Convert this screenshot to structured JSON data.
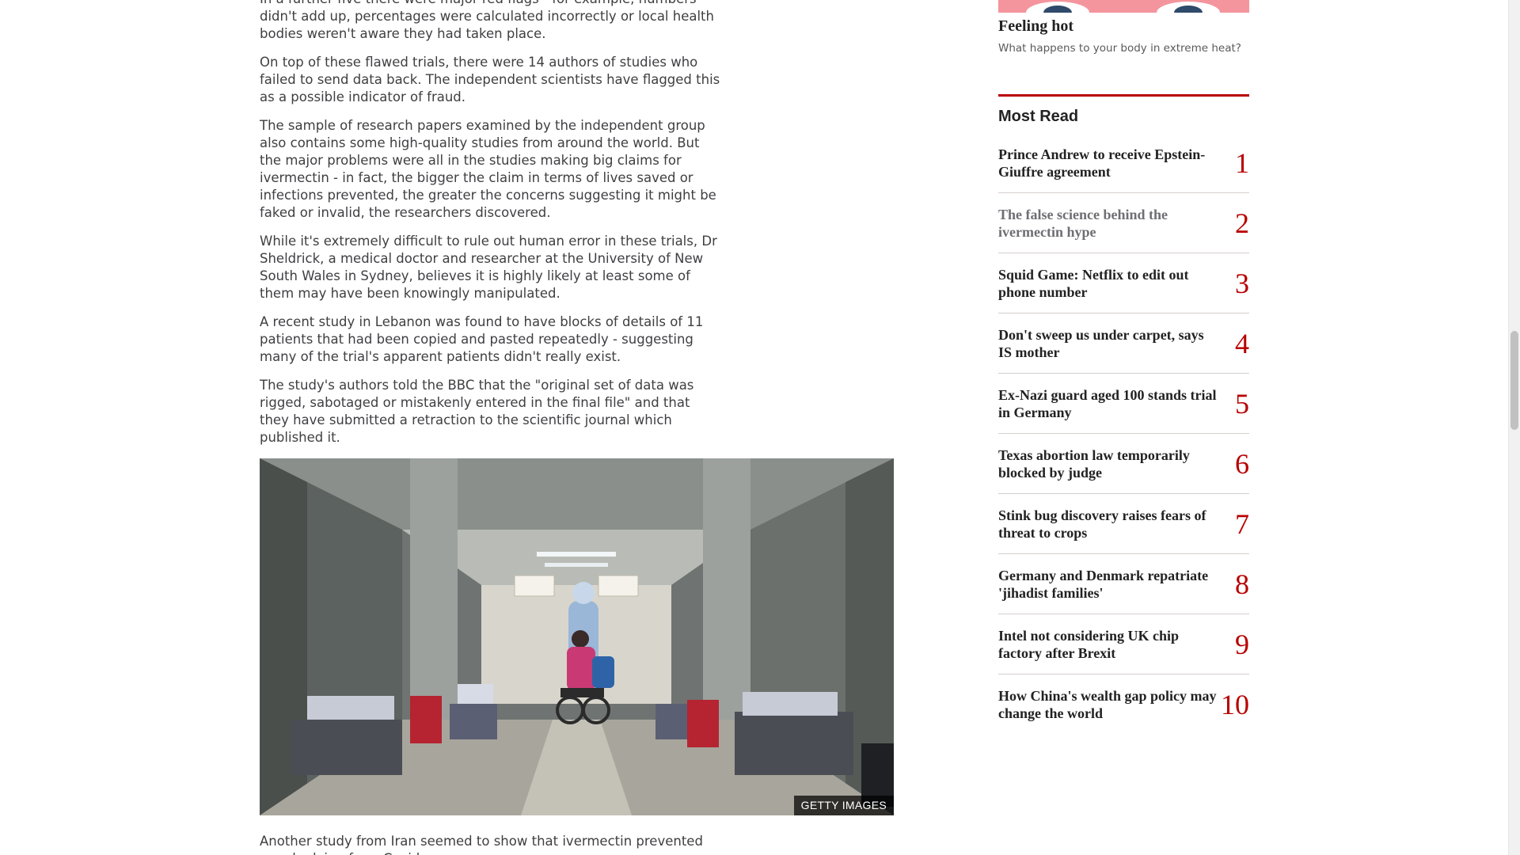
{
  "article": {
    "paragraphs": [
      "In a further five there were major red flags - for example, numbers didn't add up, percentages were calculated incorrectly or local health bodies weren't aware they had taken place.",
      "On top of these flawed trials, there were 14 authors of studies who failed to send data back. The independent scientists have flagged this as a possible indicator of fraud.",
      "The sample of research papers examined by the independent group also contains some high-quality studies from around the world. But the major problems were all in the studies making big claims for ivermectin - in fact, the bigger the claim in terms of lives saved or infections prevented, the greater the concerns suggesting it might be faked or invalid, the researchers discovered.",
      "While it's extremely difficult to rule out human error in these trials, Dr Sheldrick, a medical doctor and researcher at the University of New South Wales in Sydney, believes it is highly likely at least some of them may have been knowingly manipulated.",
      "A recent study in Lebanon was found to have blocks of details of 11 patients that had been copied and pasted repeatedly - suggesting many of the trial's apparent patients didn't really exist.",
      "The study's authors told the BBC that the \"original set of data was rigged, sabotaged or mistakenly entered in the final file\" and that they have submitted a retraction to the scientific journal which published it."
    ],
    "image_credit": "GETTY IMAGES",
    "after_image": "Another study from Iran seemed to show that ivermectin prevented people dying from Covid."
  },
  "sidebar": {
    "promo": {
      "title": "Feeling hot",
      "subtitle": "What happens to your body in extreme heat?"
    },
    "most_read": {
      "heading": "Most Read",
      "items": [
        {
          "rank": "1",
          "title": "Prince Andrew to receive Epstein-Giuffre agreement",
          "visited": false
        },
        {
          "rank": "2",
          "title": "The false science behind the ivermectin hype",
          "visited": true
        },
        {
          "rank": "3",
          "title": "Squid Game: Netflix to edit out phone number",
          "visited": false
        },
        {
          "rank": "4",
          "title": "Don't sweep us under carpet, says IS mother",
          "visited": false
        },
        {
          "rank": "5",
          "title": "Ex-Nazi guard aged 100 stands trial in Germany",
          "visited": false
        },
        {
          "rank": "6",
          "title": "Texas abortion law temporarily blocked by judge",
          "visited": false
        },
        {
          "rank": "7",
          "title": "Stink bug discovery raises fears of threat to crops",
          "visited": false
        },
        {
          "rank": "8",
          "title": "Germany and Denmark repatriate 'jihadist families'",
          "visited": false
        },
        {
          "rank": "9",
          "title": "Intel not considering UK chip factory after Brexit",
          "visited": false
        },
        {
          "rank": "10",
          "title": "How China's wealth gap policy may change the world",
          "visited": false
        }
      ]
    }
  },
  "colors": {
    "accent": "#b80000",
    "visited_link": "#6e6e73",
    "promo_background": "#f4959d"
  }
}
